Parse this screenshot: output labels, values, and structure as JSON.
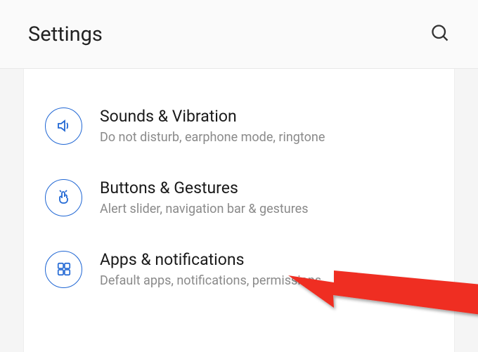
{
  "header": {
    "title": "Settings"
  },
  "items": [
    {
      "title": "Sounds & Vibration",
      "subtitle": "Do not disturb, earphone mode, ringtone"
    },
    {
      "title": "Buttons & Gestures",
      "subtitle": "Alert slider, navigation bar & gestures"
    },
    {
      "title": "Apps & notifications",
      "subtitle": "Default apps, notifications, permissions"
    }
  ],
  "colors": {
    "accent": "#2067d4",
    "arrow": "#ef2e24"
  }
}
